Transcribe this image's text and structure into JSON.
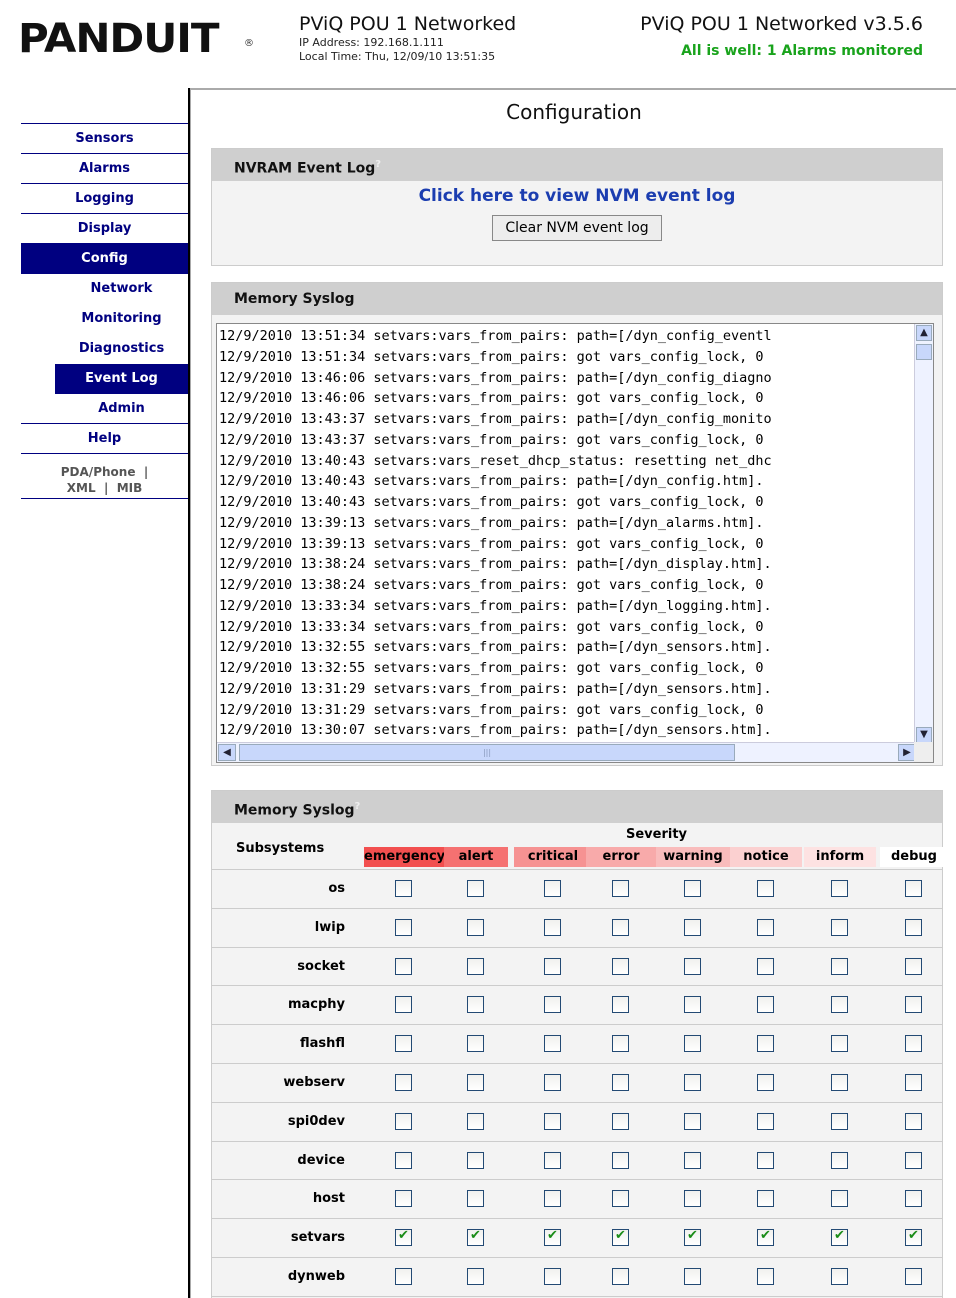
{
  "header": {
    "logo_text": "PANDUIT",
    "device_title": "PViQ POU 1 Networked",
    "ip": "IP Address: 192.168.1.111",
    "time": "Local Time: Thu, 12/09/10 13:51:35",
    "version_title": "PViQ POU 1 Networked v3.5.6",
    "status": "All is well: 1 Alarms monitored",
    "status_color": "#19a31c"
  },
  "sidebar": {
    "items": [
      {
        "label": "Sensors"
      },
      {
        "label": "Alarms"
      },
      {
        "label": "Logging"
      },
      {
        "label": "Display"
      },
      {
        "label": "Config"
      }
    ],
    "subitems": [
      {
        "label": "Network"
      },
      {
        "label": "Monitoring"
      },
      {
        "label": "Diagnostics"
      },
      {
        "label": "Event Log"
      },
      {
        "label": "Admin"
      }
    ],
    "help": "Help",
    "links": {
      "pda": "PDA/Phone",
      "xml": "XML",
      "mib": "MIB"
    },
    "nav_color": "#000080"
  },
  "page": {
    "title": "Configuration"
  },
  "nvram": {
    "title": "NVRAM Event Log",
    "help_mark": "?",
    "link": "Click here to view NVM event log",
    "clear_button": "Clear NVM event log"
  },
  "syslog": {
    "title": "Memory Syslog",
    "lines": [
      "12/9/2010 13:51:34 setvars:vars_from_pairs: path=[/dyn_config_eventl",
      "12/9/2010 13:51:34 setvars:vars_from_pairs: got vars_config_lock, 0",
      "12/9/2010 13:46:06 setvars:vars_from_pairs: path=[/dyn_config_diagno",
      "12/9/2010 13:46:06 setvars:vars_from_pairs: got vars_config_lock, 0",
      "12/9/2010 13:43:37 setvars:vars_from_pairs: path=[/dyn_config_monito",
      "12/9/2010 13:43:37 setvars:vars_from_pairs: got vars_config_lock, 0",
      "12/9/2010 13:40:43 setvars:vars_reset_dhcp_status: resetting net_dhc",
      "12/9/2010 13:40:43 setvars:vars_from_pairs: path=[/dyn_config.htm].",
      "12/9/2010 13:40:43 setvars:vars_from_pairs: got vars_config_lock, 0",
      "12/9/2010 13:39:13 setvars:vars_from_pairs: path=[/dyn_alarms.htm].",
      "12/9/2010 13:39:13 setvars:vars_from_pairs: got vars_config_lock, 0",
      "12/9/2010 13:38:24 setvars:vars_from_pairs: path=[/dyn_display.htm].",
      "12/9/2010 13:38:24 setvars:vars_from_pairs: got vars_config_lock, 0",
      "12/9/2010 13:33:34 setvars:vars_from_pairs: path=[/dyn_logging.htm].",
      "12/9/2010 13:33:34 setvars:vars_from_pairs: got vars_config_lock, 0",
      "12/9/2010 13:32:55 setvars:vars_from_pairs: path=[/dyn_sensors.htm].",
      "12/9/2010 13:32:55 setvars:vars_from_pairs: got vars_config_lock, 0",
      "12/9/2010 13:31:29 setvars:vars_from_pairs: path=[/dyn_sensors.htm].",
      "12/9/2010 13:31:29 setvars:vars_from_pairs: got vars_config_lock, 0",
      "12/9/2010 13:30:07 setvars:vars_from_pairs: path=[/dyn_sensors.htm]."
    ],
    "scroll_icons": {
      "up": "scroll-up-arrow-icon",
      "down": "scroll-down-arrow-icon",
      "left": "scroll-left-arrow-icon",
      "right": "scroll-right-arrow-icon"
    }
  },
  "matrix": {
    "title": "Memory Syslog",
    "help_mark": "?",
    "subsystems_label": "Subsystems",
    "severity_label": "Severity",
    "severities": [
      {
        "label": "emergency",
        "color": "#f24f4f"
      },
      {
        "label": "alert",
        "color": "#f57171"
      },
      {
        "label": "critical",
        "color": "#f69292"
      },
      {
        "label": "error",
        "color": "#f8aaaa"
      },
      {
        "label": "warning",
        "color": "#f9bcbc"
      },
      {
        "label": "notice",
        "color": "#fbd0d0"
      },
      {
        "label": "inform",
        "color": "#fde2e2"
      },
      {
        "label": "debug",
        "color": "#ffffff"
      }
    ],
    "rows": [
      {
        "name": "os",
        "checked": [
          false,
          false,
          false,
          false,
          false,
          false,
          false,
          false
        ]
      },
      {
        "name": "lwip",
        "checked": [
          false,
          false,
          false,
          false,
          false,
          false,
          false,
          false
        ]
      },
      {
        "name": "socket",
        "checked": [
          false,
          false,
          false,
          false,
          false,
          false,
          false,
          false
        ]
      },
      {
        "name": "macphy",
        "checked": [
          false,
          false,
          false,
          false,
          false,
          false,
          false,
          false
        ]
      },
      {
        "name": "flashfl",
        "checked": [
          false,
          false,
          false,
          false,
          false,
          false,
          false,
          false
        ]
      },
      {
        "name": "webserv",
        "checked": [
          false,
          false,
          false,
          false,
          false,
          false,
          false,
          false
        ]
      },
      {
        "name": "spi0dev",
        "checked": [
          false,
          false,
          false,
          false,
          false,
          false,
          false,
          false
        ]
      },
      {
        "name": "device",
        "checked": [
          false,
          false,
          false,
          false,
          false,
          false,
          false,
          false
        ]
      },
      {
        "name": "host",
        "checked": [
          false,
          false,
          false,
          false,
          false,
          false,
          false,
          false
        ]
      },
      {
        "name": "setvars",
        "checked": [
          true,
          true,
          true,
          true,
          true,
          true,
          true,
          true
        ]
      },
      {
        "name": "dynweb",
        "checked": [
          false,
          false,
          false,
          false,
          false,
          false,
          false,
          false
        ]
      }
    ]
  }
}
